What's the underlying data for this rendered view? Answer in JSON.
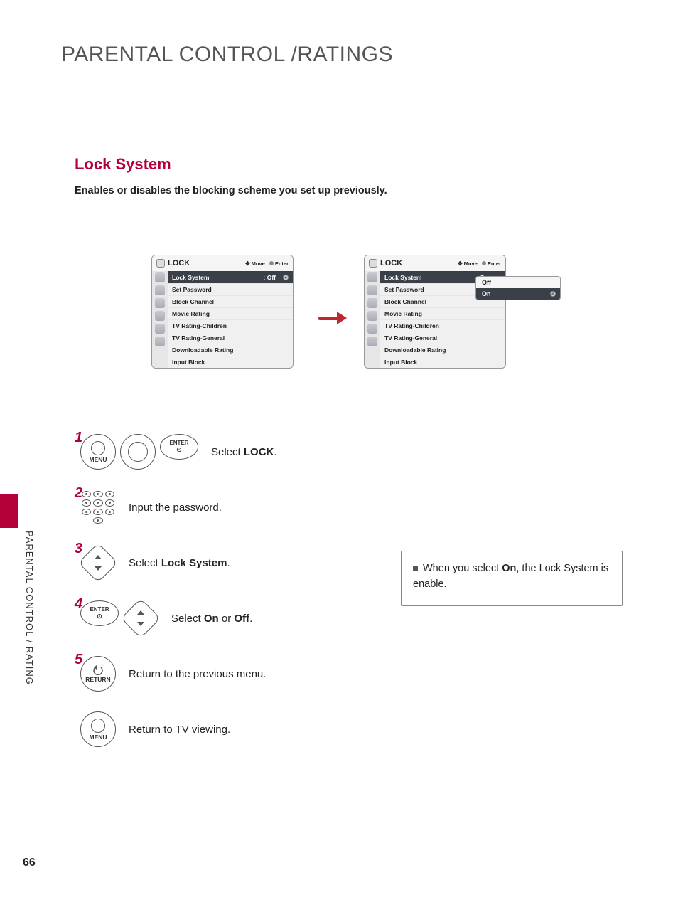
{
  "page": {
    "title": "PARENTAL CONTROL /RATINGS",
    "number": "66",
    "side_tab": "PARENTAL CONTROL / RATING"
  },
  "section": {
    "title": "Lock System",
    "description": "Enables or disables the blocking scheme you set up previously."
  },
  "osd": {
    "header_title": "LOCK",
    "hint_move": "Move",
    "hint_enter": "Enter",
    "items": [
      "Lock System",
      "Set Password",
      "Block Channel",
      "Movie Rating",
      "TV Rating-Children",
      "TV Rating-General",
      "Downloadable Rating",
      "Input Block"
    ],
    "left_value": ": Off",
    "right_value": ": On",
    "submenu": {
      "off": "Off",
      "on": "On"
    }
  },
  "buttons": {
    "menu": "MENU",
    "enter": "ENTER",
    "return": "RETURN"
  },
  "steps": {
    "s1a": "Select ",
    "s1b": "LOCK",
    "s1c": ".",
    "s2": "Input the password.",
    "s3a": "Select ",
    "s3b": "Lock System",
    "s3c": ".",
    "s4a": "Select ",
    "s4b": "On",
    "s4c": " or ",
    "s4d": "Off",
    "s4e": ".",
    "s5": "Return to the previous menu.",
    "s6": "Return to TV viewing."
  },
  "note": {
    "a": "When you select ",
    "b": "On",
    "c": ", the Lock System is enable."
  }
}
